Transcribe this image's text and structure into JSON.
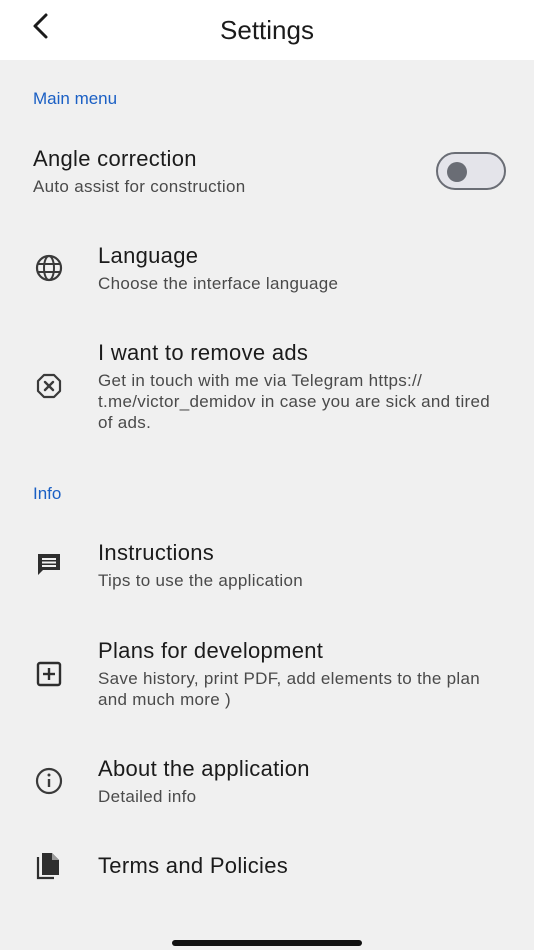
{
  "header": {
    "title": "Settings",
    "back_icon": "chevron-left-icon"
  },
  "sections": {
    "main_menu": "Main menu",
    "info": "Info"
  },
  "items": {
    "angle": {
      "title": "Angle correction",
      "subtitle": "Auto assist for construction",
      "toggle_on": false
    },
    "language": {
      "title": "Language",
      "subtitle": "Choose the interface language",
      "icon": "globe-icon"
    },
    "remove_ads": {
      "title": "I want to remove ads",
      "subtitle": "Get in touch with me via Telegram https:// t.me/victor_demidov in case you are sick and tired of ads.",
      "icon": "cancel-circle-icon"
    },
    "instructions": {
      "title": "Instructions",
      "subtitle": "Tips to use the application",
      "icon": "message-icon"
    },
    "plans": {
      "title": "Plans for development",
      "subtitle": "Save history, print PDF, add elements to the plan and much more )",
      "icon": "add-box-icon"
    },
    "about": {
      "title": "About the application",
      "subtitle": "Detailed info",
      "icon": "info-icon"
    },
    "terms": {
      "title": "Terms and Policies",
      "icon": "document-icon"
    }
  },
  "colors": {
    "accent": "#1a5fc4",
    "background": "#f0f0f0",
    "header_bg": "#ffffff"
  }
}
